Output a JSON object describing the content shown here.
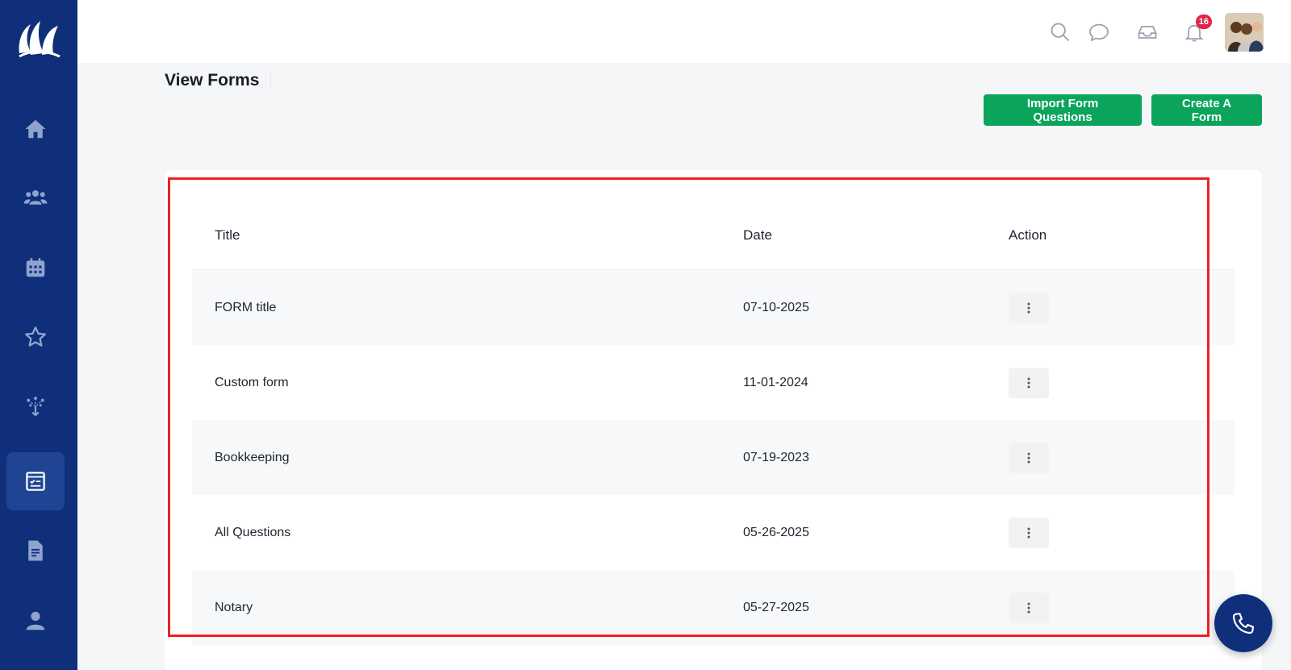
{
  "header": {
    "icons": [
      "search-icon",
      "chat-icon",
      "inbox-icon",
      "bell-icon"
    ],
    "notification_count": "16",
    "avatar": "user-avatar"
  },
  "sidebar": {
    "items": [
      {
        "icon": "home-icon"
      },
      {
        "icon": "users-icon"
      },
      {
        "icon": "calendar-icon"
      },
      {
        "icon": "star-icon"
      },
      {
        "icon": "network-icon"
      },
      {
        "icon": "forms-icon",
        "active": true
      },
      {
        "icon": "document-icon"
      },
      {
        "icon": "user-icon"
      }
    ]
  },
  "page": {
    "title": "View Forms",
    "buttons": {
      "import": "Import Form Questions",
      "create": "Create A Form"
    }
  },
  "table": {
    "columns": [
      "Title",
      "Date",
      "Action"
    ],
    "rows": [
      {
        "title": "FORM title",
        "date": "07-10-2025"
      },
      {
        "title": "Custom form",
        "date": "11-01-2024"
      },
      {
        "title": "Bookkeeping",
        "date": "07-19-2023"
      },
      {
        "title": "All Questions",
        "date": "05-26-2025"
      },
      {
        "title": "Notary",
        "date": "05-27-2025"
      }
    ]
  },
  "colors": {
    "sidebar": "#0f2f7a",
    "primary_button": "#0aa45a",
    "badge": "#e0244a",
    "highlight": "#ee2222"
  }
}
